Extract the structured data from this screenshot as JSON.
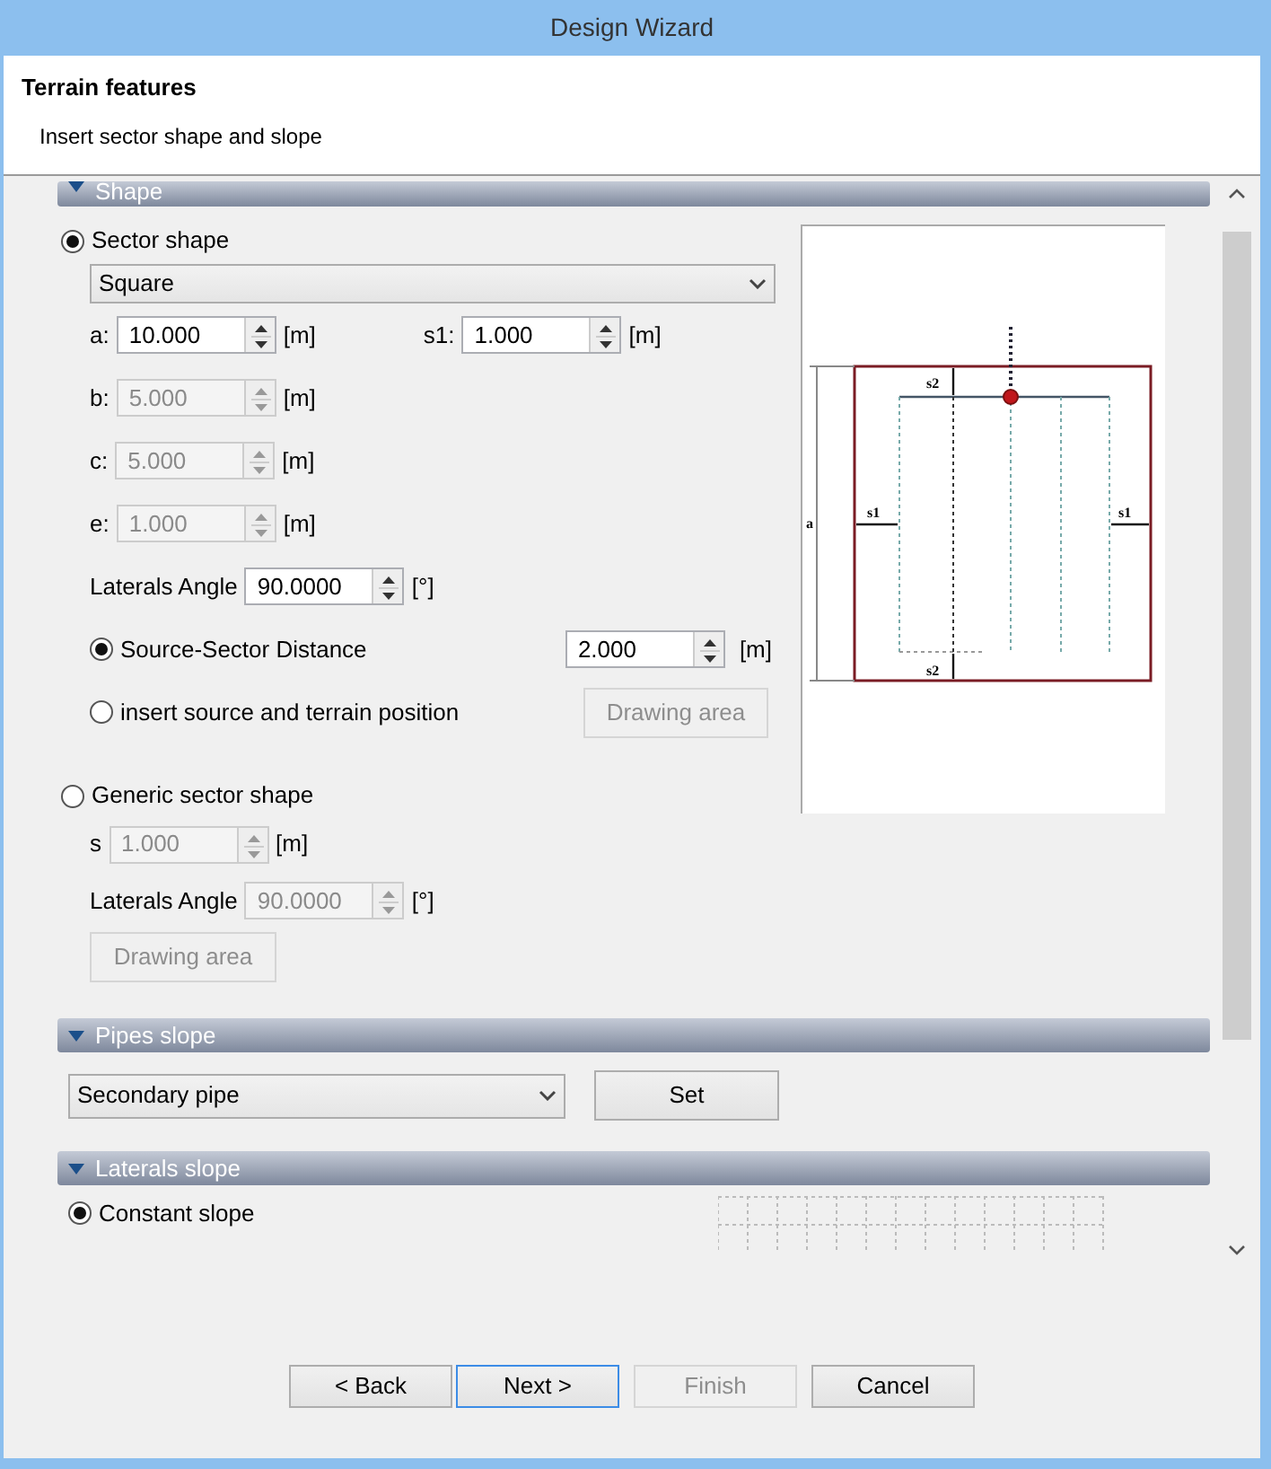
{
  "window": {
    "title": "Design Wizard"
  },
  "header": {
    "title": "Terrain features",
    "subtitle": "Insert sector shape and slope"
  },
  "shape_section": {
    "title": "Shape",
    "expanded": true
  },
  "sector_shape": {
    "label": "Sector shape",
    "selected": true,
    "dropdown": "Square",
    "rows": [
      [
        {
          "label": "a:",
          "value": "10.000",
          "unit": "[m]",
          "disabled": false
        },
        {
          "label": "s1:",
          "value": "1.000",
          "unit": "[m]",
          "disabled": false
        }
      ],
      [
        {
          "label": "b:",
          "value": "5.000",
          "unit": "[m]",
          "disabled": true
        }
      ],
      [
        {
          "label": "c:",
          "value": "5.000",
          "unit": "[m]",
          "disabled": true
        }
      ],
      [
        {
          "label": "e:",
          "value": "1.000",
          "unit": "[m]",
          "disabled": true
        }
      ],
      [
        {
          "label": "Laterals Angle",
          "value": "90.0000",
          "unit": "[°]",
          "disabled": false
        }
      ]
    ],
    "options": [
      {
        "kind": "field",
        "label": "Source-Sector Distance",
        "selected": true,
        "value": "2.000",
        "unit": "[m]",
        "disabled": false
      },
      {
        "kind": "button",
        "label": "insert source and terrain position",
        "selected": false,
        "button": "Drawing area",
        "disabled": true
      }
    ]
  },
  "diagram": {
    "labels": [
      "a",
      "s1",
      "s1",
      "s2",
      "s2"
    ]
  },
  "generic_shape": {
    "label": "Generic sector shape",
    "selected": false,
    "rows": [
      [
        {
          "label": "s",
          "value": "1.000",
          "unit": "[m]",
          "disabled": true
        }
      ],
      [
        {
          "label": "Laterals Angle",
          "value": "90.0000",
          "unit": "[°]",
          "disabled": true
        }
      ]
    ],
    "button": {
      "label": "Drawing area",
      "disabled": true
    }
  },
  "pipes_section": {
    "title": "Pipes slope",
    "expanded": true,
    "dropdown": "Secondary pipe",
    "button": "Set"
  },
  "laterals_section": {
    "title": "Laterals slope",
    "expanded": true,
    "option": {
      "label": "Constant slope",
      "selected": true
    }
  },
  "buttons": [
    {
      "label": "< Back",
      "disabled": false,
      "default": false
    },
    {
      "label": "Next >",
      "disabled": false,
      "default": true
    },
    {
      "label": "Finish",
      "disabled": true,
      "default": false
    },
    {
      "label": "Cancel",
      "disabled": false,
      "default": false
    }
  ]
}
